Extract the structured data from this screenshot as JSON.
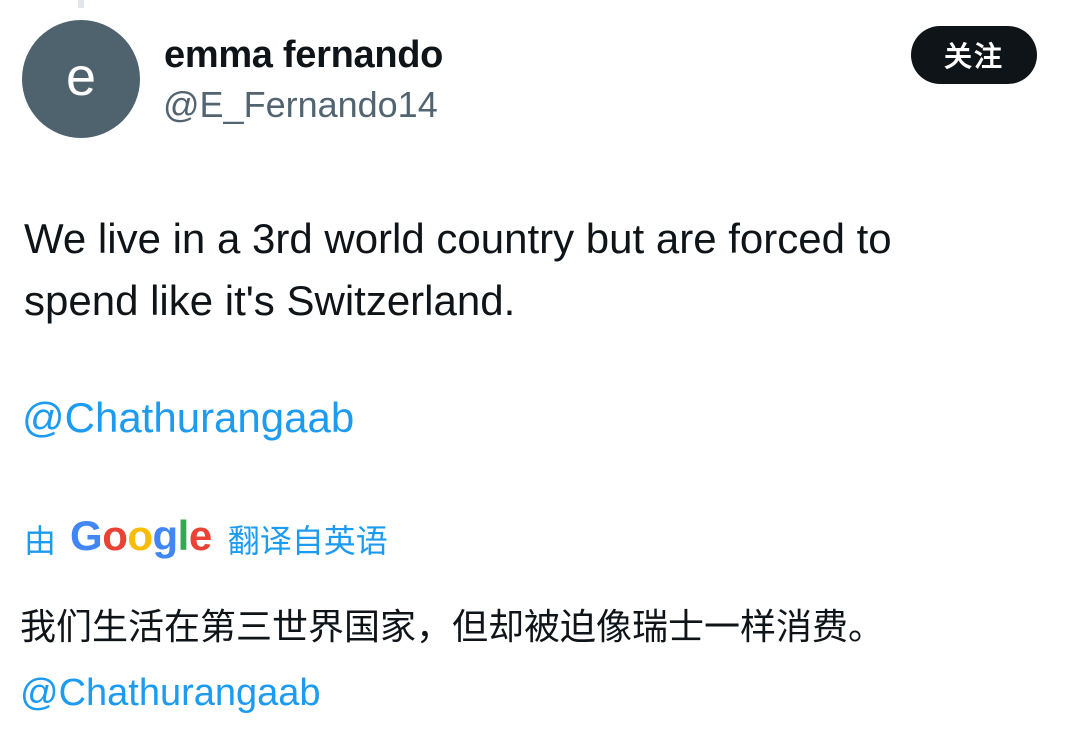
{
  "author": {
    "avatar_letter": "e",
    "avatar_color": "#4f636f",
    "display_name": "emma fernando",
    "handle": "@E_Fernando14"
  },
  "follow_button": {
    "label": "关注"
  },
  "tweet": {
    "text_lines": [
      "We live in a 3rd world country but are forced to",
      "spend like it's Switzerland."
    ],
    "mention": "@Chathurangaab"
  },
  "translation": {
    "by_label": "由",
    "provider_letters": [
      "G",
      "o",
      "o",
      "g",
      "l",
      "e"
    ],
    "translated_from_label": "翻译自英语",
    "translated_text": "我们生活在第三世界国家，但却被迫像瑞士一样消费。",
    "mention": "@Chathurangaab"
  },
  "colors": {
    "link": "#1d9bf0",
    "text": "#0f1419",
    "secondary": "#536471",
    "follow_bg": "#0f1419"
  },
  "icons": [
    "google-logo"
  ]
}
